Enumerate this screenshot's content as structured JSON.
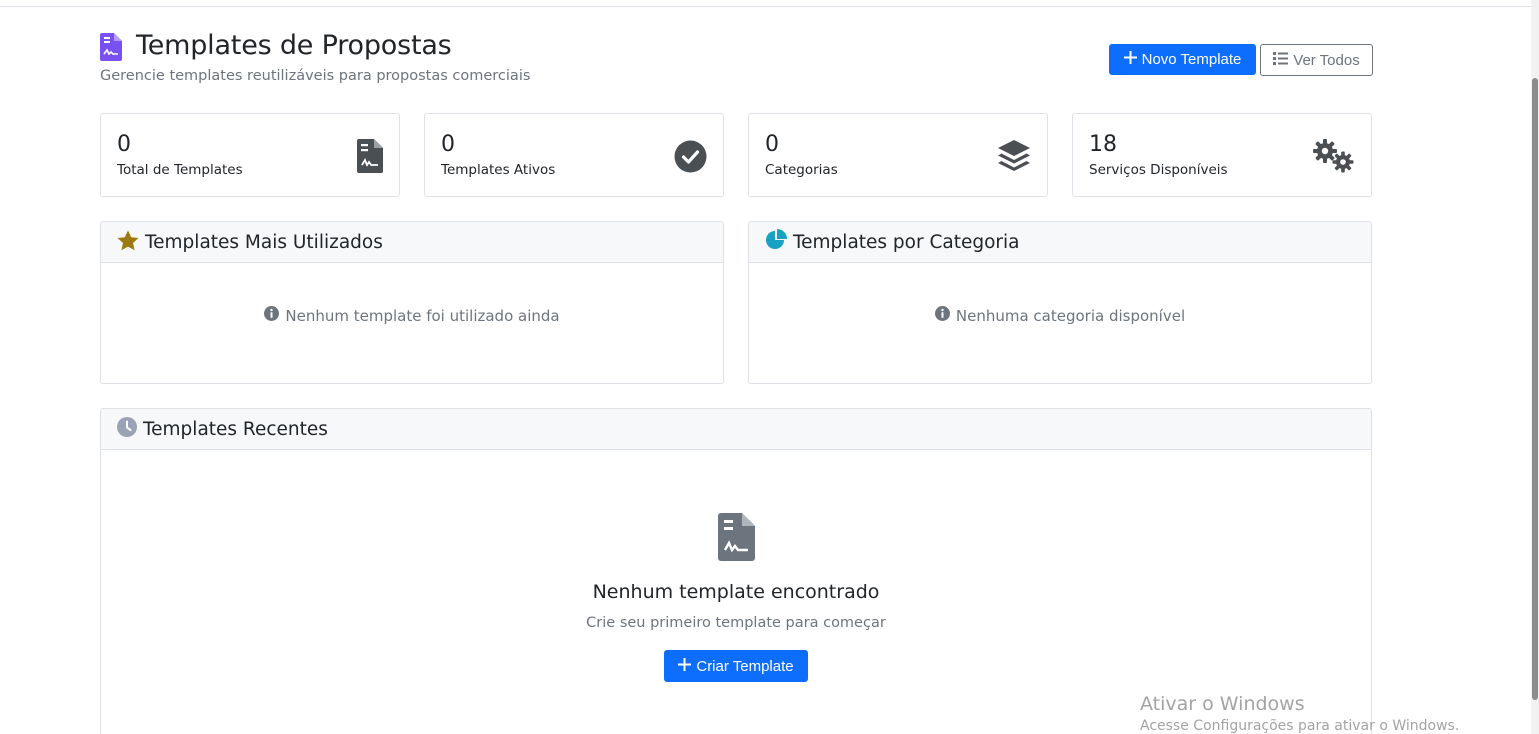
{
  "header": {
    "title": "Templates de Propostas",
    "subtitle": "Gerencie templates reutilizáveis para propostas comerciais",
    "new_button": "Novo Template",
    "view_all_button": "Ver Todos",
    "title_icon": "file-contract-icon",
    "accent_color": "#7950f2",
    "primary_color": "#0d6efd"
  },
  "stats": [
    {
      "value": "0",
      "label": "Total de Templates",
      "icon": "file-contract-icon"
    },
    {
      "value": "0",
      "label": "Templates Ativos",
      "icon": "check-circle-icon"
    },
    {
      "value": "0",
      "label": "Categorias",
      "icon": "layers-icon"
    },
    {
      "value": "18",
      "label": "Serviços Disponíveis",
      "icon": "gears-icon"
    }
  ],
  "most_used": {
    "title": "Templates Mais Utilizados",
    "icon": "star-icon",
    "empty_text": "Nenhum template foi utilizado ainda"
  },
  "by_category": {
    "title": "Templates por Categoria",
    "icon": "pie-chart-icon",
    "empty_text": "Nenhuma categoria disponível"
  },
  "recent": {
    "title": "Templates Recentes",
    "icon": "clock-icon",
    "empty_title": "Nenhum template encontrado",
    "empty_subtitle": "Crie seu primeiro template para começar",
    "create_button": "Criar Template"
  },
  "watermark": {
    "title": "Ativar o Windows",
    "subtitle": "Acesse Configurações para ativar o Windows."
  }
}
